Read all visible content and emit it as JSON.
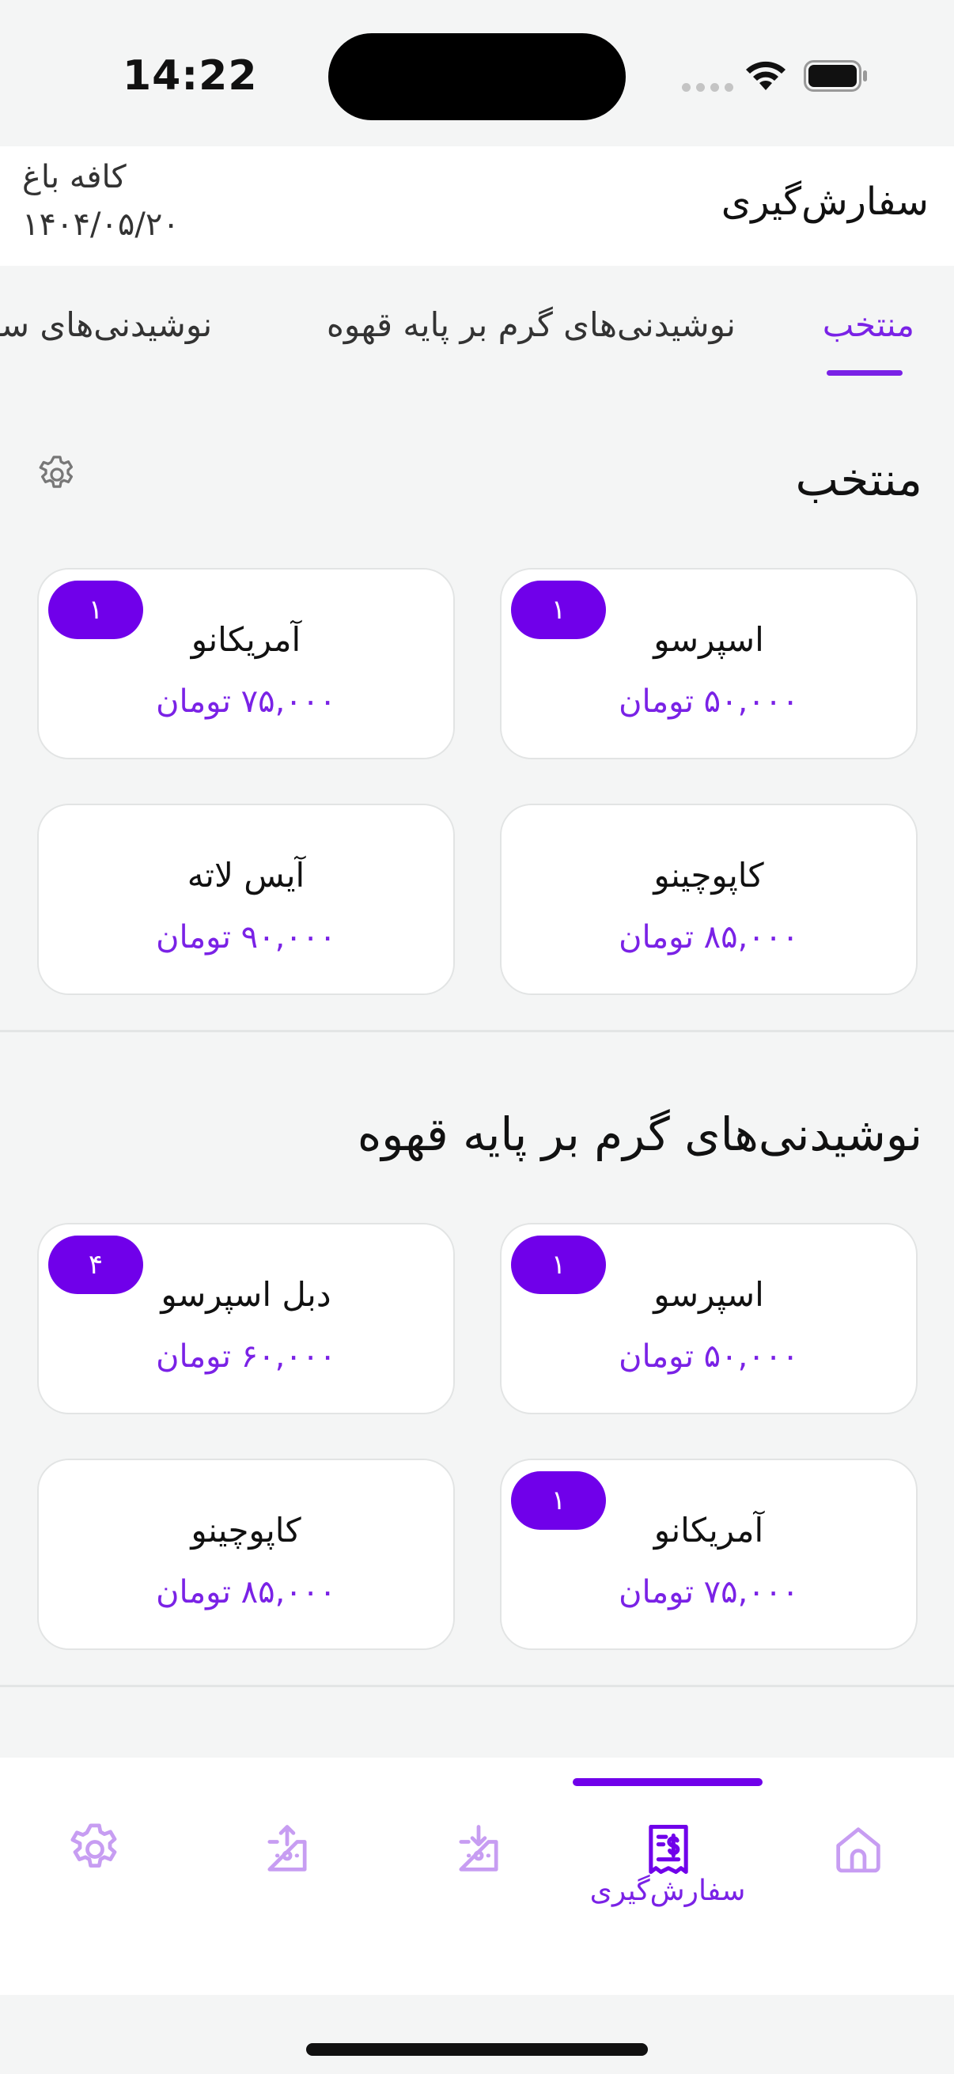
{
  "status_bar": {
    "time": "14:22"
  },
  "header": {
    "title": "سفارش‌گیری",
    "cafe_name": "کافه باغ",
    "date": "۱۴۰۴/۰۵/۲۰"
  },
  "tabs": [
    {
      "label": "منتخب",
      "active": true
    },
    {
      "label": "نوشیدنی‌های گرم بر پایه قهوه",
      "active": false
    },
    {
      "label": "نوشیدنی‌های سرد",
      "active": false
    }
  ],
  "sections": [
    {
      "title": "منتخب",
      "items": [
        {
          "name": "اسپرسو",
          "price": "۵۰,۰۰۰ تومان",
          "qty": "۱"
        },
        {
          "name": "آمریکانو",
          "price": "۷۵,۰۰۰ تومان",
          "qty": "۱"
        },
        {
          "name": "کاپوچینو",
          "price": "۸۵,۰۰۰ تومان",
          "qty": ""
        },
        {
          "name": "آیس لاته",
          "price": "۹۰,۰۰۰ تومان",
          "qty": ""
        }
      ]
    },
    {
      "title": "نوشیدنی‌های گرم بر پایه قهوه",
      "items": [
        {
          "name": "اسپرسو",
          "price": "۵۰,۰۰۰ تومان",
          "qty": "۱"
        },
        {
          "name": "دبل اسپرسو",
          "price": "۶۰,۰۰۰ تومان",
          "qty": "۴"
        },
        {
          "name": "آمریکانو",
          "price": "۷۵,۰۰۰ تومان",
          "qty": "۱"
        },
        {
          "name": "کاپوچینو",
          "price": "۸۵,۰۰۰ تومان",
          "qty": ""
        }
      ]
    }
  ],
  "bottom_nav": {
    "items": [
      {
        "icon": "home-icon",
        "label": ""
      },
      {
        "icon": "receipt-icon",
        "label": "سفارش‌گیری",
        "active": true
      },
      {
        "icon": "box-in-icon",
        "label": ""
      },
      {
        "icon": "box-out-icon",
        "label": ""
      },
      {
        "icon": "gear-icon",
        "label": ""
      }
    ]
  },
  "colors": {
    "accent": "#7a22e6",
    "badge": "#7000ea",
    "background": "#f4f5f5"
  }
}
